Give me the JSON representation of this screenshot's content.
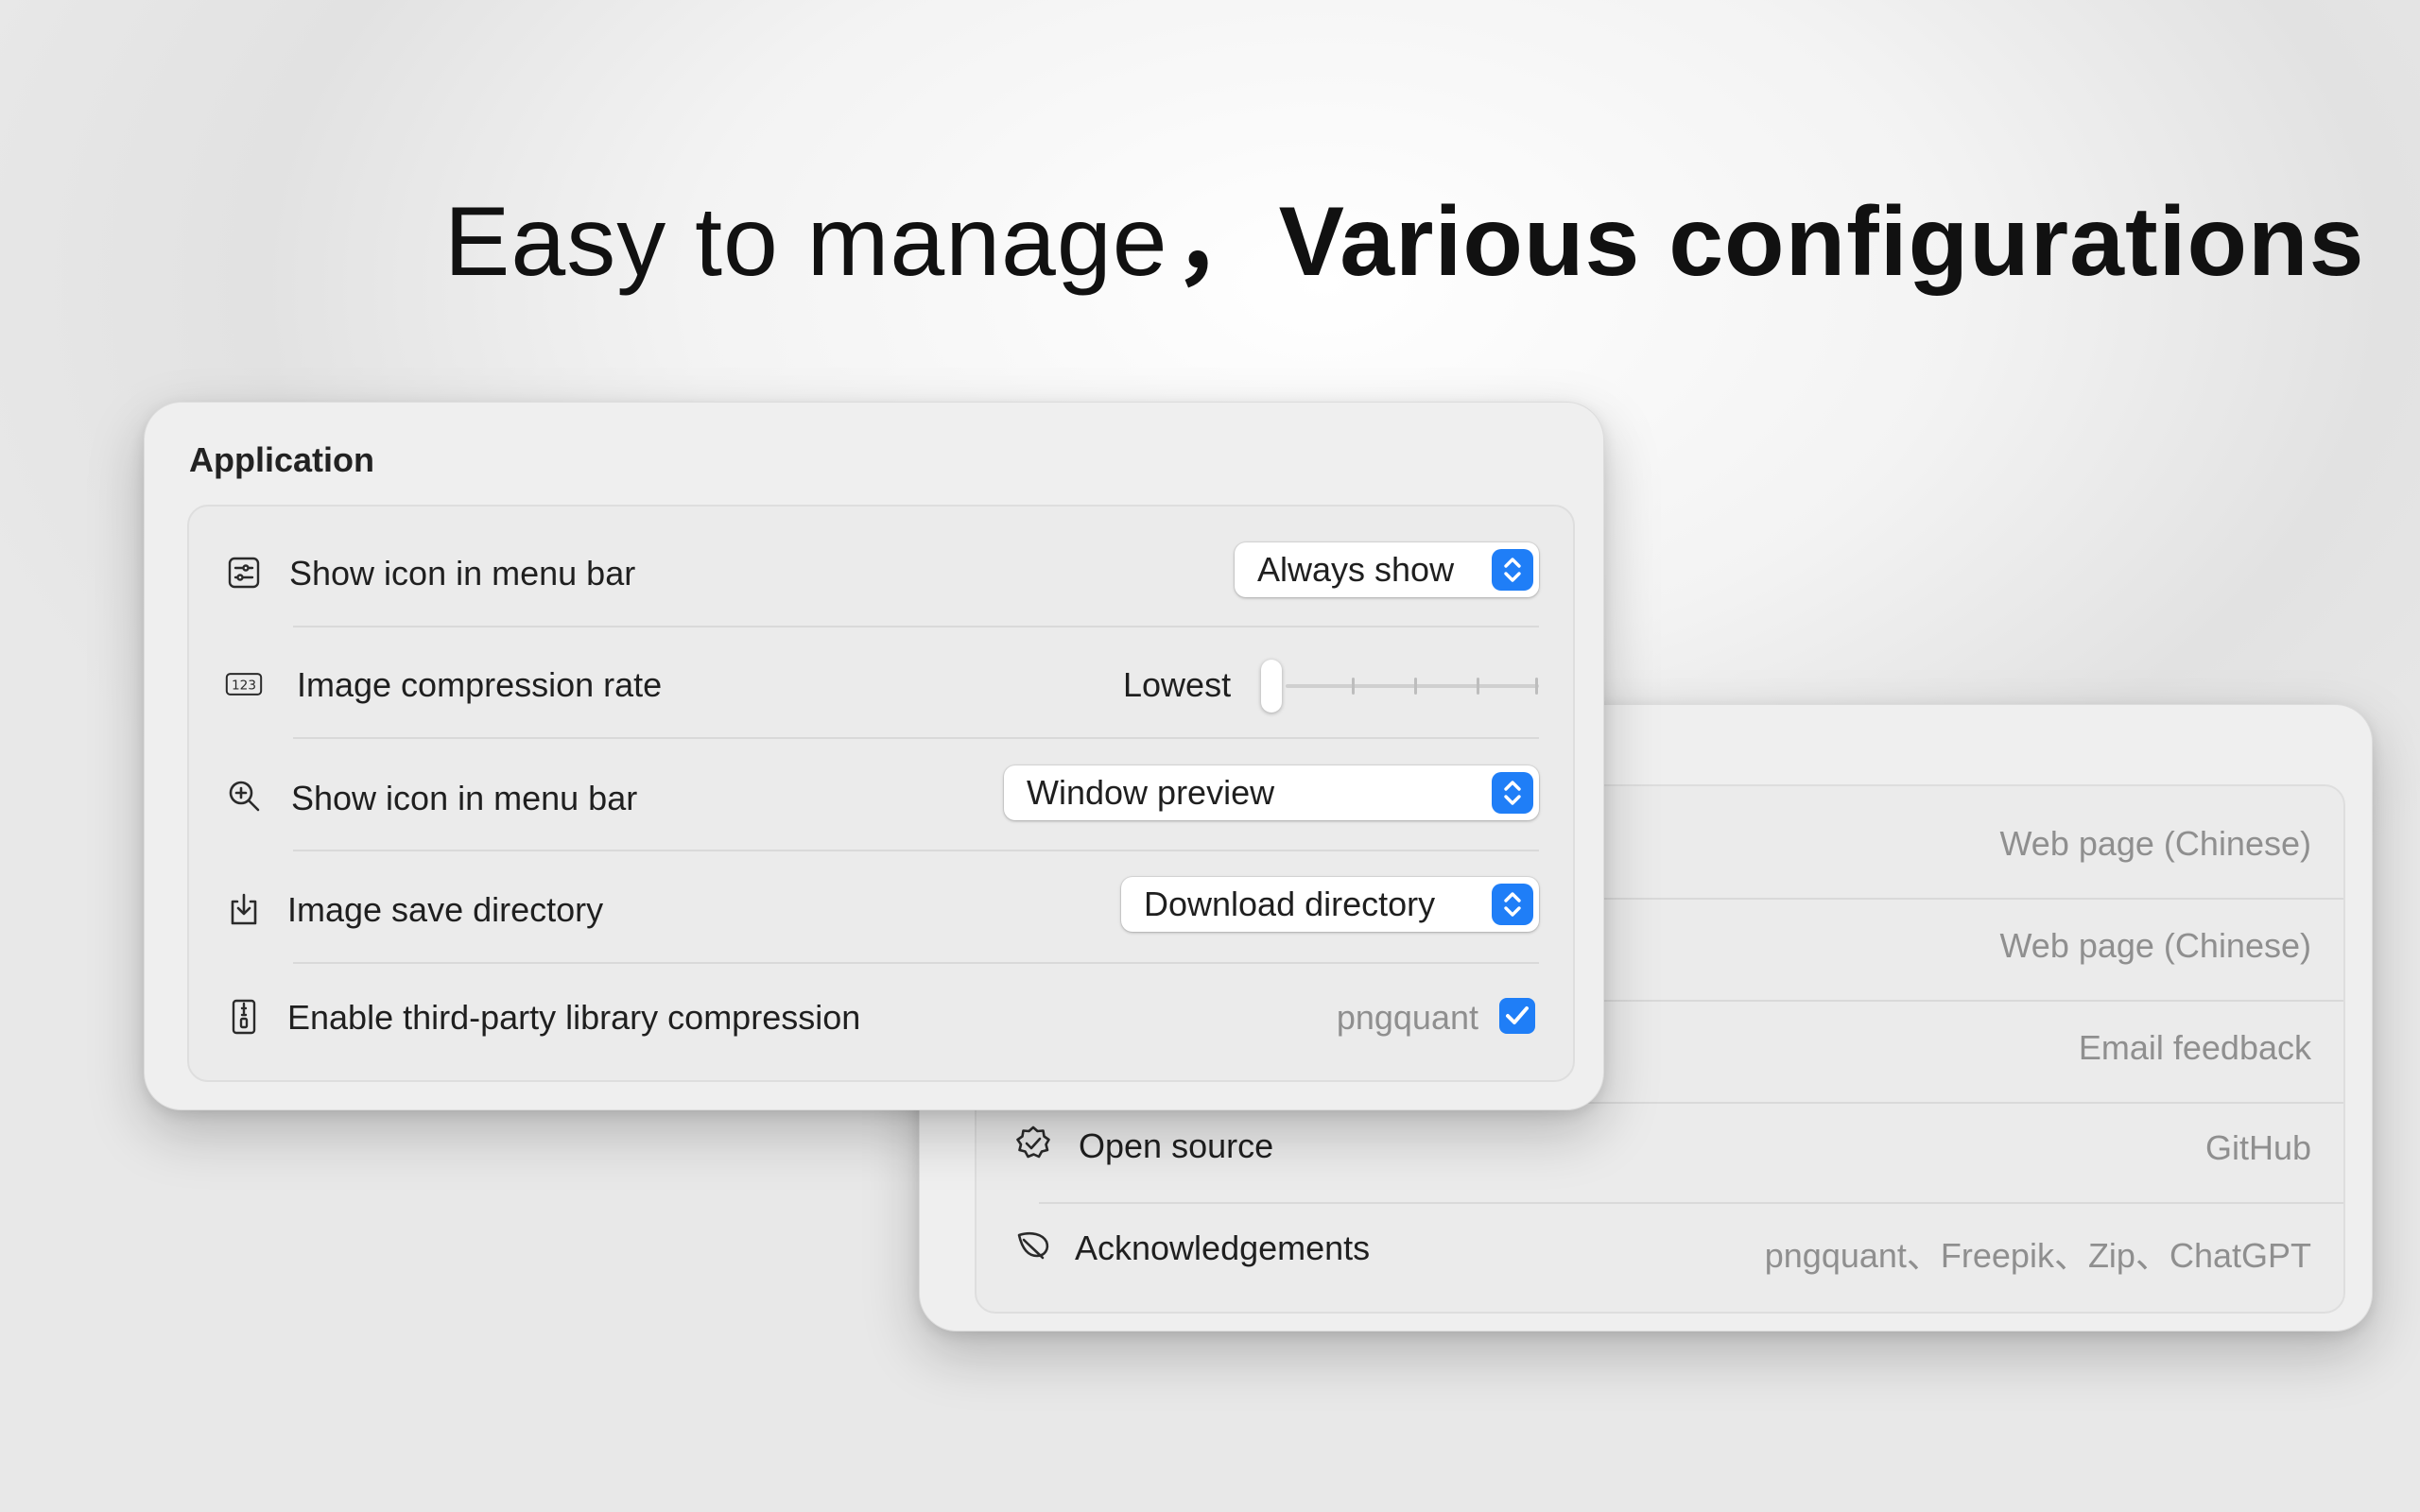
{
  "headline": {
    "light": "Easy to manage",
    "separator": "，",
    "bold": "Various configurations"
  },
  "back_panel": {
    "rows": [
      {
        "label": "",
        "value": "Web page (Chinese)"
      },
      {
        "label": "",
        "value": "Web page (Chinese)"
      },
      {
        "label": "",
        "value": "Email feedback"
      },
      {
        "label": "Open source",
        "value": "GitHub",
        "icon": "verified-badge-icon"
      },
      {
        "label": "Acknowledgements",
        "value": "pngquant、Freepik、Zip、ChatGPT",
        "icon": "leaf-icon"
      }
    ]
  },
  "front_panel": {
    "title": "Application",
    "rows": [
      {
        "label": "Show icon in menu bar",
        "icon": "sliders-window-icon",
        "control": "popup",
        "value": "Always show"
      },
      {
        "label": "Image compression rate",
        "icon": "numbers-123-icon",
        "control": "slider",
        "value": "Lowest",
        "slider_position": 0,
        "slider_steps": 5
      },
      {
        "label": "Show icon in menu bar",
        "icon": "zoom-in-icon",
        "control": "popup",
        "value": "Window preview"
      },
      {
        "label": "Image save directory",
        "icon": "download-tray-icon",
        "control": "popup",
        "value": "Download directory"
      },
      {
        "label": "Enable third-party library compression",
        "icon": "zip-file-icon",
        "control": "checkbox",
        "value": "pngquant",
        "checked": true
      }
    ]
  },
  "colors": {
    "accent": "#1f7ef7",
    "panel": "#efefef",
    "text": "#1f1f1f",
    "secondary_text": "#8f8f8f"
  }
}
